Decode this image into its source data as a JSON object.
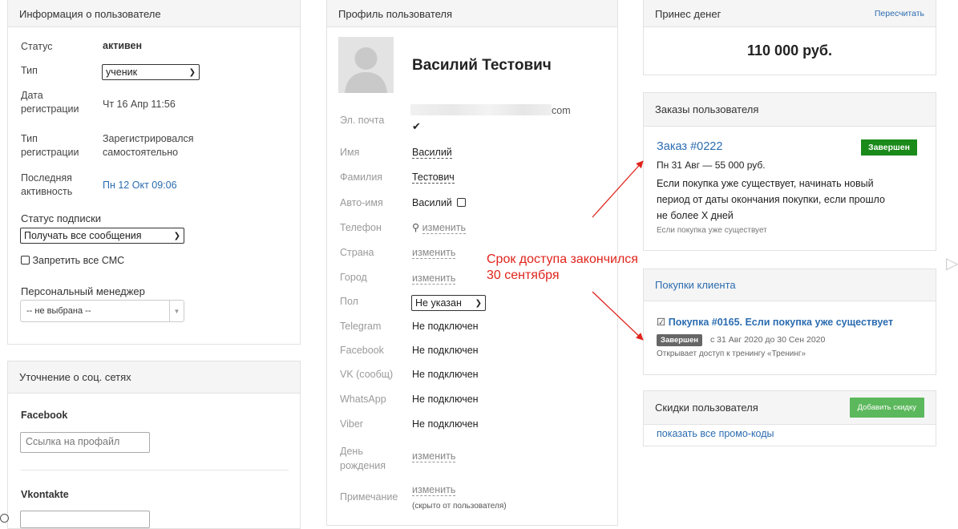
{
  "user_info": {
    "header": "Информация о пользователе",
    "status_label": "Статус",
    "status_value": "активен",
    "type_label": "Тип",
    "type_value": "ученик",
    "reg_date_label_1": "Дата",
    "reg_date_label_2": "регистрации",
    "reg_date_value": "Чт 16 Апр 11:56",
    "reg_type_label_1": "Тип",
    "reg_type_label_2": "регистрации",
    "reg_type_value_1": "Зарегистрировался",
    "reg_type_value_2": "самостоятельно",
    "last_active_label_1": "Последняя",
    "last_active_label_2": "активность",
    "last_active_value": "Пн 12 Окт 09:06",
    "subscription_label": "Статус подписки",
    "subscription_value": "Получать все сообщения",
    "block_sms_label": "Запретить все СМС",
    "manager_label": "Персональный менеджер",
    "manager_value": "-- не выбрана --"
  },
  "social": {
    "header": "Уточнение о соц. сетях",
    "facebook_label": "Facebook",
    "facebook_placeholder": "Ссылка на профайл",
    "vk_label": "Vkontakte"
  },
  "profile": {
    "header": "Профиль пользователя",
    "name": "Василий Тестович",
    "email_label": "Эл. почта",
    "email_suffix": "com",
    "first_name_label": "Имя",
    "first_name_value": "Василий",
    "last_name_label": "Фамилия",
    "last_name_value": "Тестович",
    "auto_name_label": "Авто-имя",
    "auto_name_value": "Василий",
    "phone_label": "Телефон",
    "phone_action": "изменить",
    "country_label": "Страна",
    "country_action": "изменить",
    "city_label": "Город",
    "city_action": "изменить",
    "gender_label": "Пол",
    "gender_value": "Не указан",
    "telegram_label": "Telegram",
    "telegram_value": "Не подключен",
    "facebook_label": "Facebook",
    "facebook_value": "Не подключен",
    "vk_label": "VK (сообщ)",
    "vk_value": "Не подключен",
    "whatsapp_label": "WhatsApp",
    "whatsapp_value": "Не подключен",
    "viber_label": "Viber",
    "viber_value": "Не подключен",
    "birthday_label_1": "День",
    "birthday_label_2": "рождения",
    "birthday_action": "изменить",
    "note_label": "Примечание",
    "note_action": "изменить",
    "note_hint": "(скрыто от пользователя)"
  },
  "money": {
    "header": "Принес денег",
    "recalc": "Пересчитать",
    "amount": "110 000 руб."
  },
  "orders": {
    "header": "Заказы пользователя",
    "order_link": "Заказ #0222",
    "order_status": "Завершен",
    "order_meta": "Пн 31 Авг — 55 000 руб.",
    "order_desc_1": "Если покупка уже существует, начинать новый",
    "order_desc_2": "период от даты окончания покупки, если прошло",
    "order_desc_3": "не более X дней",
    "order_note": "Если покупка уже существует"
  },
  "purchases": {
    "header": "Покупки клиента",
    "purchase_link": "Покупка #0165. Если покупка уже существует",
    "purchase_status": "Завершен",
    "purchase_period": "с 31 Авг 2020 до 30 Сен 2020",
    "purchase_access": "Открывает доступ к тренингу «Тренинг»"
  },
  "discounts": {
    "header": "Скидки пользователя",
    "add_button": "Добавить скидку",
    "show_promos": "показать все промо-коды"
  },
  "annotation": {
    "line_1": "Срок доступа закончился",
    "line_2": "30 сентября",
    "color": "#e0241c"
  }
}
